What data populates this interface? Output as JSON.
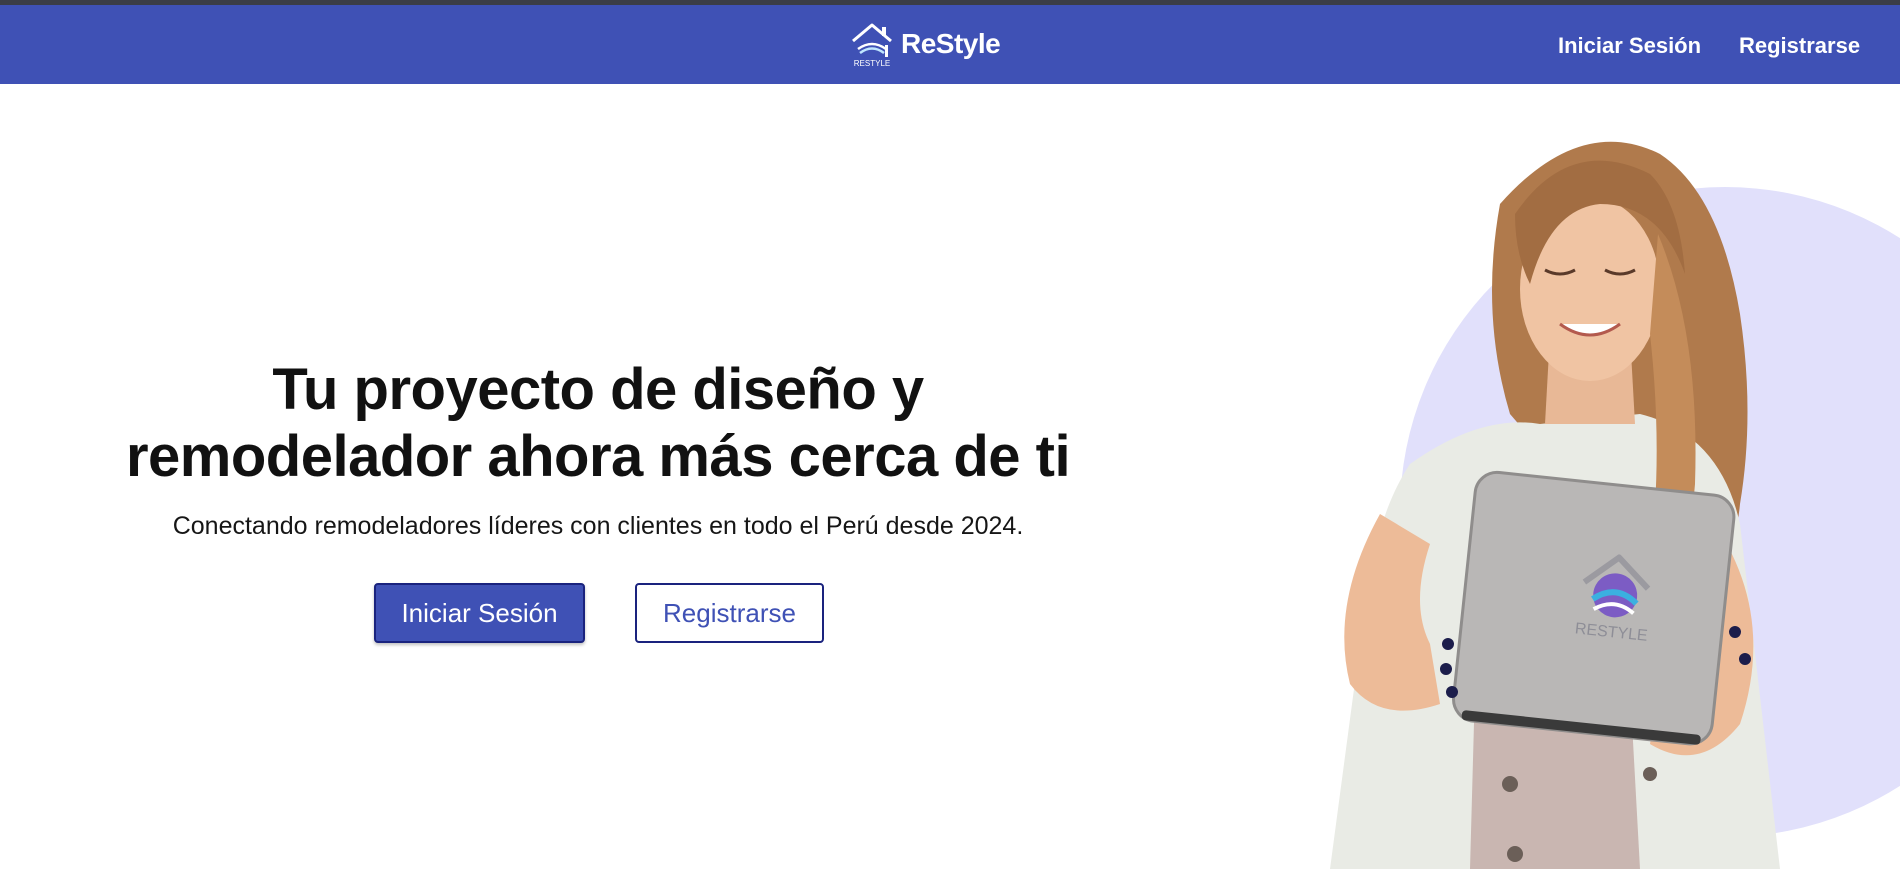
{
  "header": {
    "brand_name": "ReStyle",
    "brand_mark_text": "RESTYLE",
    "login_label": "Iniciar Sesión",
    "register_label": "Registrarse"
  },
  "hero": {
    "title_line1": "Tu proyecto de diseño y",
    "title_line2": "remodelador ahora más cerca de ti",
    "subtitle": "Conectando remodeladores líderes con clientes en todo el Perú desde 2024.",
    "login_button": "Iniciar Sesión",
    "register_button": "Registrarse",
    "tablet_logo_text": "RESTYLE"
  },
  "colors": {
    "primary": "#3f51b5",
    "primary_dark": "#1a237e",
    "circle": "#e1e0fb"
  }
}
